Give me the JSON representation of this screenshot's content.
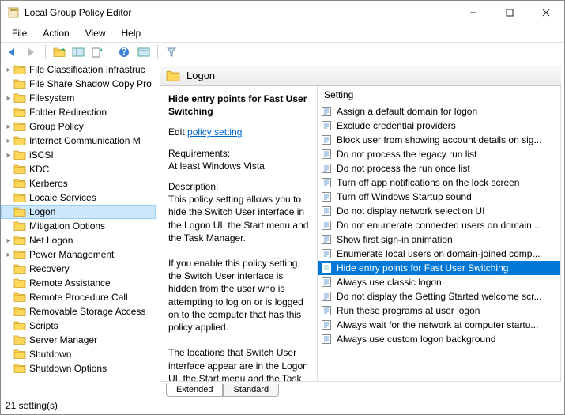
{
  "window": {
    "title": "Local Group Policy Editor"
  },
  "menu": {
    "file": "File",
    "action": "Action",
    "view": "View",
    "help": "Help"
  },
  "tree": [
    {
      "label": "File Classification Infrastruc",
      "sel": false,
      "expand": "▸"
    },
    {
      "label": "File Share Shadow Copy Pro",
      "sel": false,
      "expand": ""
    },
    {
      "label": "Filesystem",
      "sel": false,
      "expand": "▸"
    },
    {
      "label": "Folder Redirection",
      "sel": false,
      "expand": ""
    },
    {
      "label": "Group Policy",
      "sel": false,
      "expand": "▸"
    },
    {
      "label": "Internet Communication M",
      "sel": false,
      "expand": "▸"
    },
    {
      "label": "iSCSI",
      "sel": false,
      "expand": "▸"
    },
    {
      "label": "KDC",
      "sel": false,
      "expand": ""
    },
    {
      "label": "Kerberos",
      "sel": false,
      "expand": ""
    },
    {
      "label": "Locale Services",
      "sel": false,
      "expand": ""
    },
    {
      "label": "Logon",
      "sel": true,
      "expand": ""
    },
    {
      "label": "Mitigation Options",
      "sel": false,
      "expand": ""
    },
    {
      "label": "Net Logon",
      "sel": false,
      "expand": "▸"
    },
    {
      "label": "Power Management",
      "sel": false,
      "expand": "▸"
    },
    {
      "label": "Recovery",
      "sel": false,
      "expand": ""
    },
    {
      "label": "Remote Assistance",
      "sel": false,
      "expand": ""
    },
    {
      "label": "Remote Procedure Call",
      "sel": false,
      "expand": ""
    },
    {
      "label": "Removable Storage Access",
      "sel": false,
      "expand": ""
    },
    {
      "label": "Scripts",
      "sel": false,
      "expand": ""
    },
    {
      "label": "Server Manager",
      "sel": false,
      "expand": ""
    },
    {
      "label": "Shutdown",
      "sel": false,
      "expand": ""
    },
    {
      "label": "Shutdown Options",
      "sel": false,
      "expand": ""
    }
  ],
  "header": {
    "title": "Logon"
  },
  "desc": {
    "title": "Hide entry points for Fast User Switching",
    "editLabel": "Edit ",
    "editLink": "policy setting ",
    "reqLabel": "Requirements:",
    "reqValue": "At least Windows Vista",
    "descLabel": "Description:",
    "body1": "This policy setting allows you to hide the Switch User interface in the Logon UI, the Start menu and the Task Manager.",
    "body2": "If you enable this policy setting, the Switch User interface is hidden from the user who is attempting to log on or is logged on to the computer that has this policy applied.",
    "body3": "The locations that Switch User interface appear are in the Logon UI, the Start menu and the Task"
  },
  "listHeader": "Setting",
  "settings": [
    {
      "label": "Assign a default domain for logon",
      "sel": false
    },
    {
      "label": "Exclude credential providers",
      "sel": false
    },
    {
      "label": "Block user from showing account details on sig...",
      "sel": false
    },
    {
      "label": "Do not process the legacy run list",
      "sel": false
    },
    {
      "label": "Do not process the run once list",
      "sel": false
    },
    {
      "label": "Turn off app notifications on the lock screen",
      "sel": false
    },
    {
      "label": "Turn off Windows Startup sound",
      "sel": false
    },
    {
      "label": "Do not display network selection UI",
      "sel": false
    },
    {
      "label": "Do not enumerate connected users on domain...",
      "sel": false
    },
    {
      "label": "Show first sign-in animation",
      "sel": false
    },
    {
      "label": "Enumerate local users on domain-joined comp...",
      "sel": false
    },
    {
      "label": "Hide entry points for Fast User Switching",
      "sel": true
    },
    {
      "label": "Always use classic logon",
      "sel": false
    },
    {
      "label": "Do not display the Getting Started welcome scr...",
      "sel": false
    },
    {
      "label": "Run these programs at user logon",
      "sel": false
    },
    {
      "label": "Always wait for the network at computer startu...",
      "sel": false
    },
    {
      "label": "Always use custom logon background",
      "sel": false
    }
  ],
  "tabs": {
    "extended": "Extended",
    "standard": "Standard"
  },
  "status": "21 setting(s)"
}
